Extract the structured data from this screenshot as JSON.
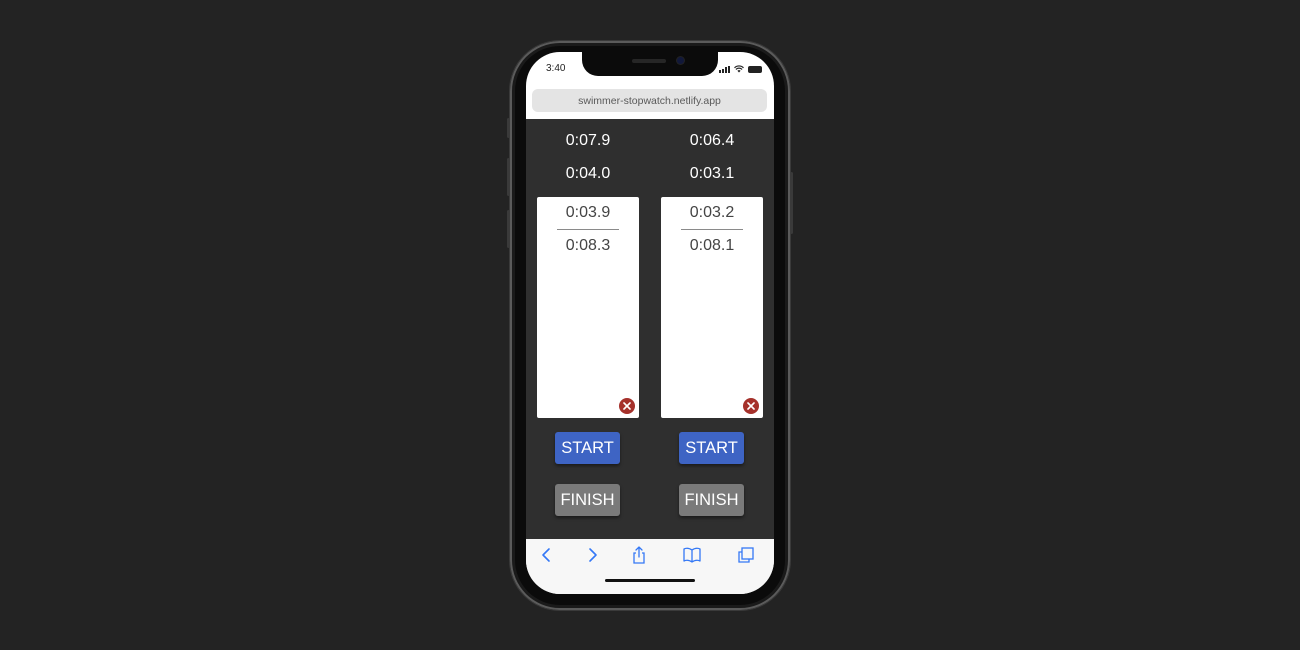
{
  "status_bar": {
    "time": "3:40"
  },
  "browser": {
    "url": "swimmer-stopwatch.netlify.app"
  },
  "lanes": [
    {
      "total_time": "0:07.9",
      "current_split": "0:04.0",
      "laps": [
        "0:03.9",
        "0:08.3"
      ],
      "start_label": "START",
      "finish_label": "FINISH"
    },
    {
      "total_time": "0:06.4",
      "current_split": "0:03.1",
      "laps": [
        "0:03.2",
        "0:08.1"
      ],
      "start_label": "START",
      "finish_label": "FINISH"
    }
  ],
  "colors": {
    "background": "#232323",
    "app_background": "#2f2f2f",
    "start_button": "#3e64c4",
    "finish_button": "#7a7a7a",
    "clear_button": "#a5312b",
    "toolbar_icon": "#3478f6"
  },
  "icons": {
    "toolbar": [
      "back-icon",
      "forward-icon",
      "share-icon",
      "bookmarks-icon",
      "tabs-icon"
    ],
    "clear": "close-circle-icon"
  }
}
